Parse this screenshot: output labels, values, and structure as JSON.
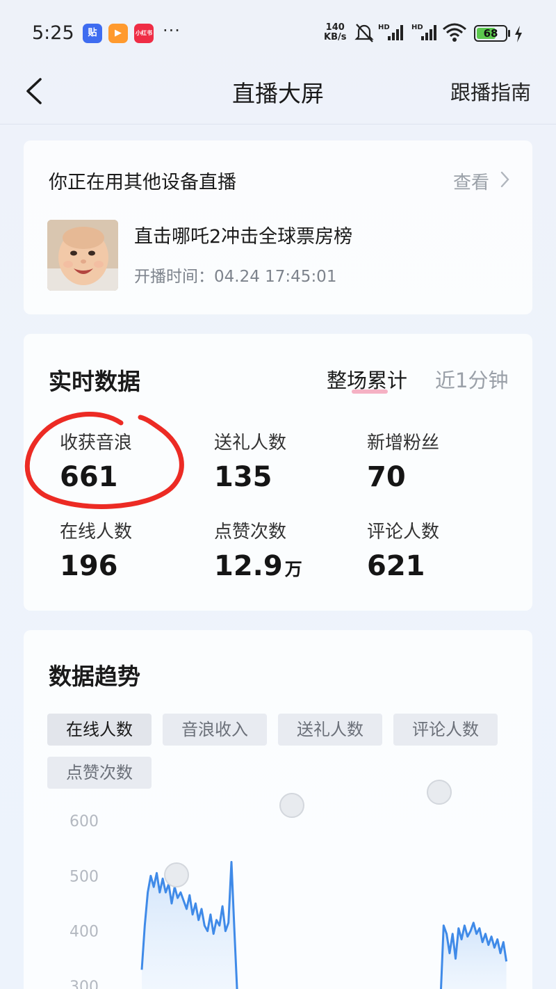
{
  "status_bar": {
    "time": "5:25",
    "apps": [
      {
        "name": "tieba-app-icon",
        "glyph": "贴",
        "color": "#3e6cf0"
      },
      {
        "name": "video-app-icon",
        "glyph": "▶",
        "color": "#ff9a2e"
      },
      {
        "name": "xiaohongshu-app-icon",
        "glyph": "小红书",
        "color": "#ef2d45"
      }
    ],
    "more": "···",
    "net_speed_value": "140",
    "net_speed_unit": "KB/s",
    "hd_label": "HD",
    "battery": "68",
    "battery_percent": 68
  },
  "navbar": {
    "title": "直播大屏",
    "guide": "跟播指南"
  },
  "live_card": {
    "title": "你正在用其他设备直播",
    "view": "查看",
    "stream_title": "直击哪吒2冲击全球票房榜",
    "start_time": "开播时间：04.24 17:45:01"
  },
  "realtime": {
    "title": "实时数据",
    "tab_total": "整场累计",
    "tab_recent": "近1分钟",
    "metrics": [
      {
        "label": "收获音浪",
        "value": "661",
        "unit": ""
      },
      {
        "label": "送礼人数",
        "value": "135",
        "unit": ""
      },
      {
        "label": "新增粉丝",
        "value": "70",
        "unit": ""
      },
      {
        "label": "在线人数",
        "value": "196",
        "unit": ""
      },
      {
        "label": "点赞次数",
        "value": "12.9",
        "unit": "万"
      },
      {
        "label": "评论人数",
        "value": "621",
        "unit": ""
      }
    ]
  },
  "trend": {
    "title": "数据趋势",
    "chips": [
      "在线人数",
      "音浪收入",
      "送礼人数",
      "评论人数",
      "点赞次数"
    ],
    "active_chip": 0
  },
  "chart_data": {
    "type": "line",
    "series_color": "#3f8ae8",
    "y_ticks": [
      600,
      500,
      400,
      300
    ],
    "ylim": [
      280,
      620
    ],
    "x": [
      0,
      1,
      2,
      3,
      4,
      5,
      6,
      7,
      8,
      9,
      10,
      11,
      12,
      13,
      14,
      15,
      16,
      17,
      18,
      19,
      20,
      21,
      22,
      23,
      24,
      25,
      26,
      27,
      28,
      29,
      30,
      31,
      32,
      33,
      34,
      35,
      36,
      37,
      38,
      39,
      40
    ],
    "segments": [
      {
        "start": 0,
        "values": [
          330,
          410,
          470,
          500,
          480,
          505,
          470,
          495,
          470,
          485,
          450,
          480,
          460,
          470,
          455,
          440,
          465,
          430,
          450,
          420,
          440,
          410,
          400,
          430,
          395,
          420,
          410,
          445,
          400,
          415,
          525,
          400,
          280
        ]
      },
      {
        "start": 100,
        "values": [
          280,
          410,
          395,
          360,
          395,
          350,
          405,
          385,
          410,
          390,
          400,
          415,
          395,
          405,
          380,
          395,
          375,
          390,
          370,
          385,
          360,
          380,
          345
        ]
      }
    ]
  }
}
